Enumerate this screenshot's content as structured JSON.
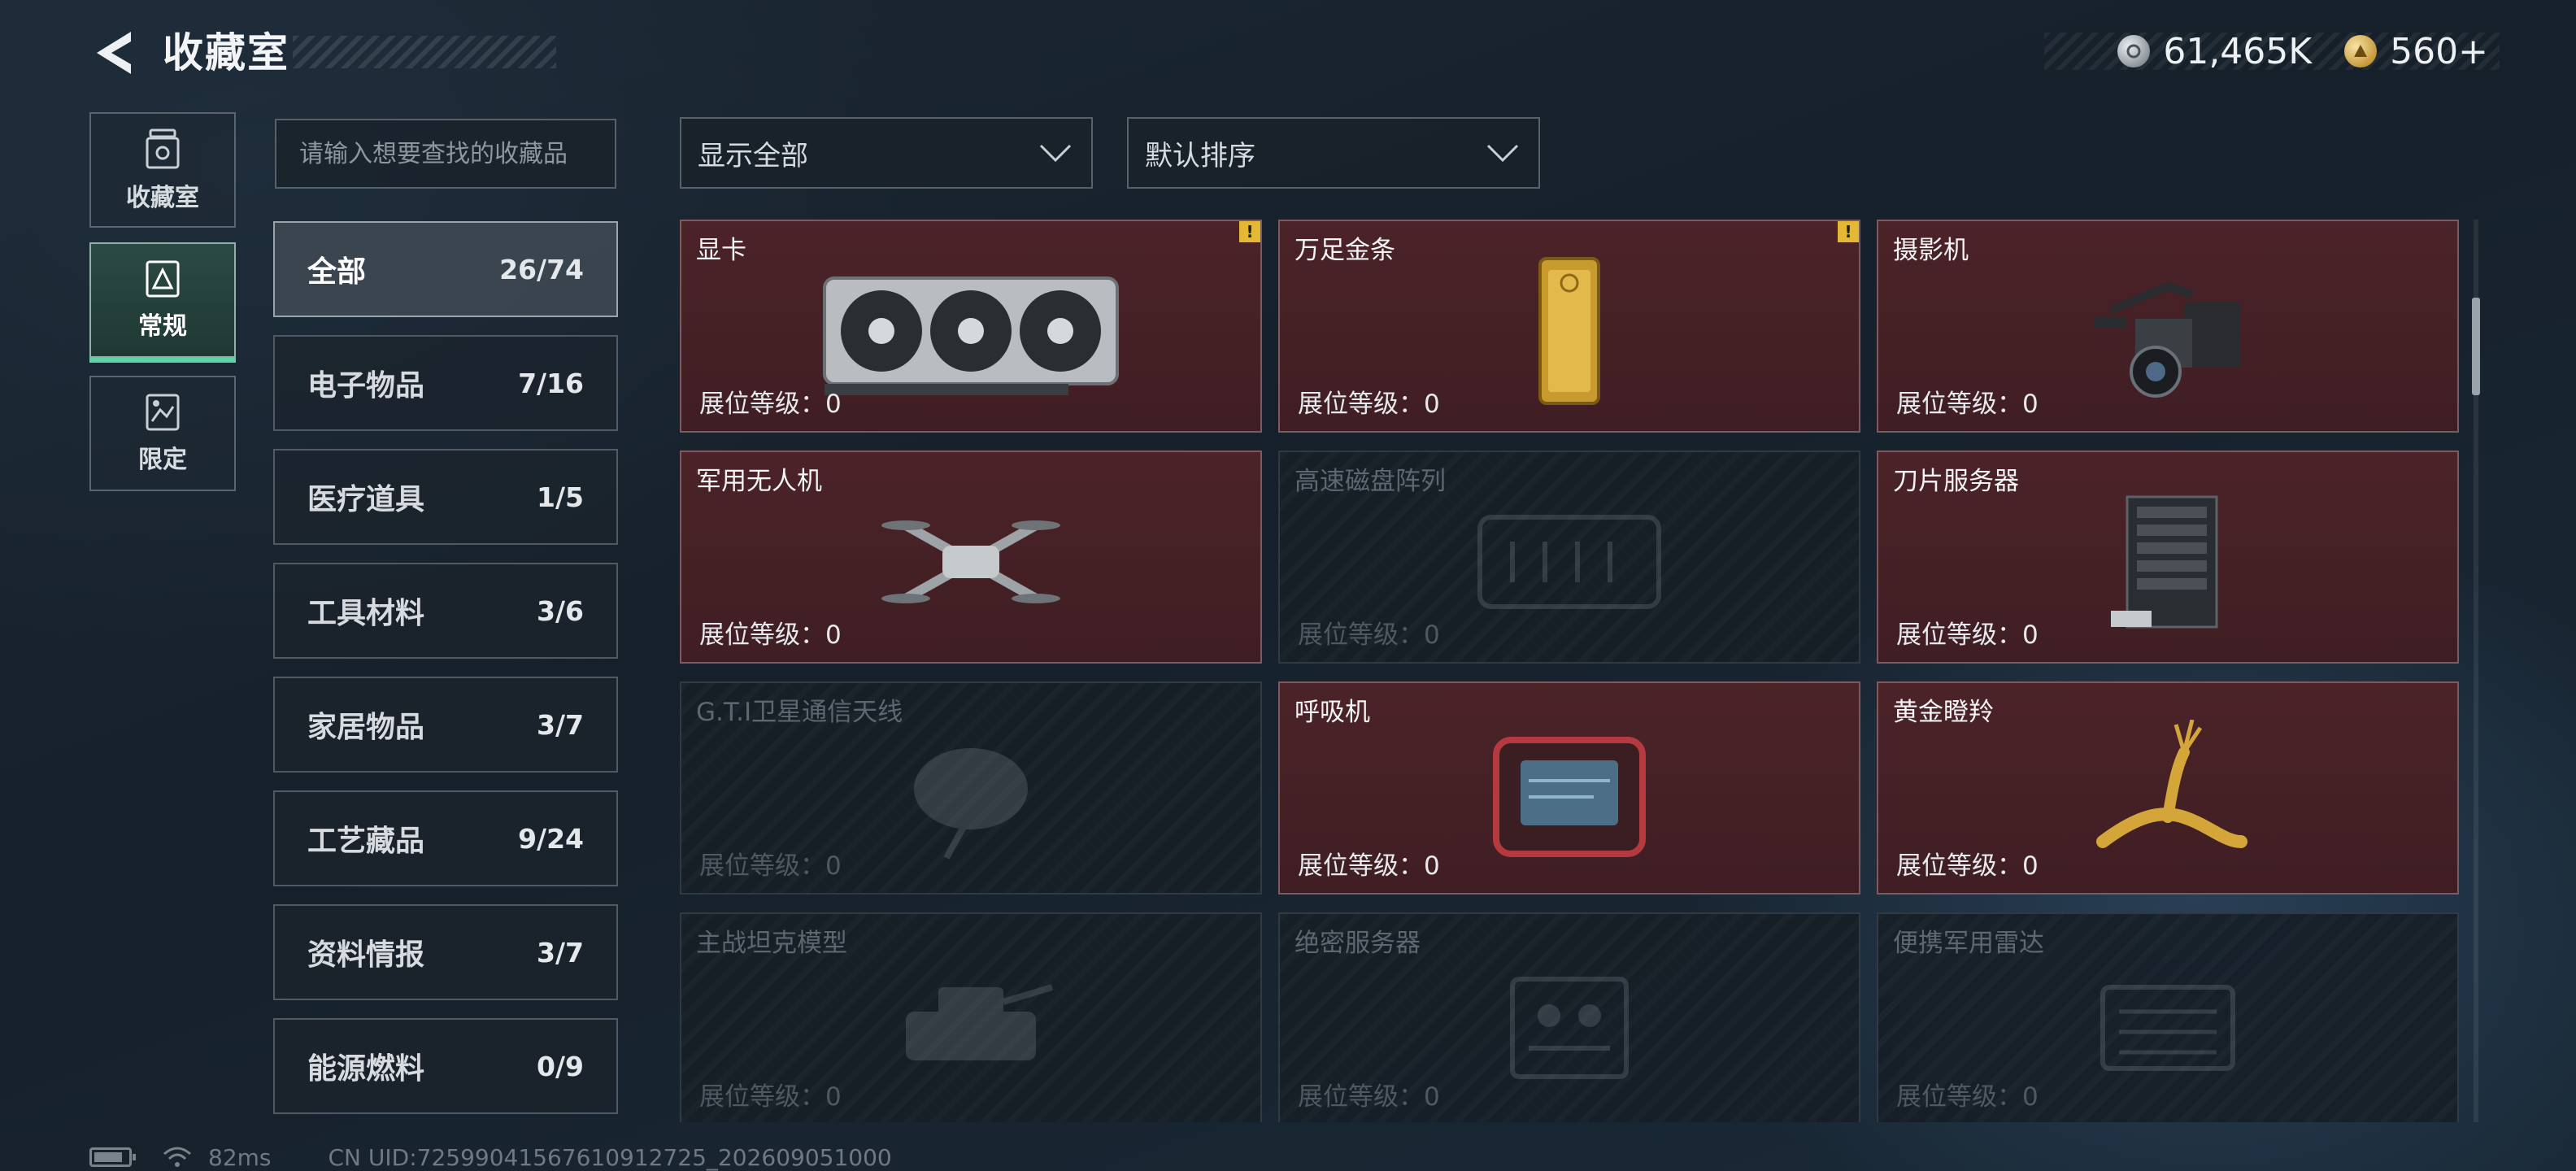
{
  "header": {
    "title": "收藏室",
    "currencies": [
      {
        "icon": "silver-coin-icon",
        "value": "61,465K"
      },
      {
        "icon": "gold-coin-icon",
        "value": "560+"
      }
    ]
  },
  "nav": {
    "tabs": [
      {
        "label": "收藏室",
        "icon": "collection-room-icon"
      },
      {
        "label": "常规",
        "icon": "regular-collection-icon"
      },
      {
        "label": "限定",
        "icon": "limited-collection-icon"
      }
    ],
    "active_index": 1
  },
  "search": {
    "placeholder": "请输入想要查找的收藏品"
  },
  "filters": {
    "display": "显示全部",
    "sort": "默认排序"
  },
  "categories": [
    {
      "name": "全部",
      "count": "26/74"
    },
    {
      "name": "电子物品",
      "count": "7/16"
    },
    {
      "name": "医疗道具",
      "count": "1/5"
    },
    {
      "name": "工具材料",
      "count": "3/6"
    },
    {
      "name": "家居物品",
      "count": "3/7"
    },
    {
      "name": "工艺藏品",
      "count": "9/24"
    },
    {
      "name": "资料情报",
      "count": "3/7"
    },
    {
      "name": "能源燃料",
      "count": "0/9"
    }
  ],
  "level_label": "展位等级：0",
  "items": [
    {
      "name": "显卡",
      "level": "展位等级：0",
      "unlocked": true,
      "alert": "!",
      "icon": "graphics-card-icon"
    },
    {
      "name": "万足金条",
      "level": "展位等级：0",
      "unlocked": true,
      "alert": "!",
      "icon": "gold-bar-icon"
    },
    {
      "name": "摄影机",
      "level": "展位等级：0",
      "unlocked": true,
      "alert": "",
      "icon": "video-camera-icon"
    },
    {
      "name": "军用无人机",
      "level": "展位等级：0",
      "unlocked": true,
      "alert": "",
      "icon": "drone-icon"
    },
    {
      "name": "高速磁盘阵列",
      "level": "展位等级：0",
      "unlocked": false,
      "alert": "",
      "icon": "disk-array-icon"
    },
    {
      "name": "刀片服务器",
      "level": "展位等级：0",
      "unlocked": true,
      "alert": "",
      "icon": "blade-server-icon"
    },
    {
      "name": "G.T.I卫星通信天线",
      "level": "展位等级：0",
      "unlocked": false,
      "alert": "",
      "icon": "satellite-antenna-icon"
    },
    {
      "name": "呼吸机",
      "level": "展位等级：0",
      "unlocked": true,
      "alert": "",
      "icon": "ventilator-icon"
    },
    {
      "name": "黄金瞪羚",
      "level": "展位等级：0",
      "unlocked": true,
      "alert": "",
      "icon": "golden-gazelle-icon"
    },
    {
      "name": "主战坦克模型",
      "level": "展位等级：0",
      "unlocked": false,
      "alert": "",
      "icon": "tank-model-icon"
    },
    {
      "name": "绝密服务器",
      "level": "展位等级：0",
      "unlocked": false,
      "alert": "",
      "icon": "secret-server-icon"
    },
    {
      "name": "便携军用雷达",
      "level": "展位等级：0",
      "unlocked": false,
      "alert": "",
      "icon": "portable-radar-icon"
    }
  ],
  "footer": {
    "ping": "82ms",
    "uid": "CN UID:72599041567610912725_202609051000"
  }
}
